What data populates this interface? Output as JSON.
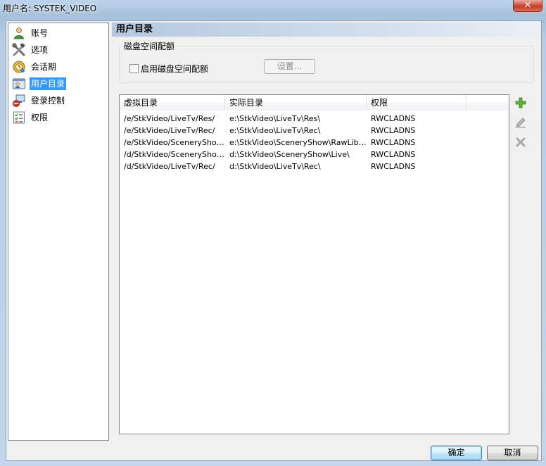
{
  "window": {
    "title": "用户名: SYSTEK_VIDEO",
    "close_glyph": "✕"
  },
  "nav": {
    "items": [
      {
        "label": "账号",
        "icon": "user-icon"
      },
      {
        "label": "选项",
        "icon": "tools-icon"
      },
      {
        "label": "会话期",
        "icon": "session-icon"
      },
      {
        "label": "用户目录",
        "icon": "folder-user-icon",
        "selected": true
      },
      {
        "label": "登录控制",
        "icon": "login-control-icon"
      },
      {
        "label": "权限",
        "icon": "permissions-icon"
      }
    ]
  },
  "section": {
    "title": "用户目录"
  },
  "quota": {
    "group_title": "磁盘空间配额",
    "enable_label": "启用磁盘空间配额",
    "enabled": false,
    "settings_label": "设置..."
  },
  "table": {
    "columns": [
      "虚拟目录",
      "实际目录",
      "权限"
    ],
    "rows": [
      [
        "/e/StkVideo/LiveTv/Res/",
        "e:\\StkVideo\\LiveTv\\Res\\",
        "RWCLADNS"
      ],
      [
        "/e/StkVideo/LiveTv/Rec/",
        "e:\\StkVideo\\LiveTv\\Rec\\",
        "RWCLADNS"
      ],
      [
        "/e/StkVideo/SceneryShow...",
        "e:\\StkVideo\\SceneryShow\\RawLib\\...",
        "RWCLADNS"
      ],
      [
        "/d/StkVideo/SceneryShow...",
        "d:\\StkVideo\\SceneryShow\\Live\\",
        "RWCLADNS"
      ],
      [
        "/d/StkVideo/LiveTv/Rec/",
        "d:\\StkVideo\\LiveTv\\Rec\\",
        "RWCLADNS"
      ]
    ]
  },
  "tools": {
    "add_icon": "add-icon",
    "edit_icon": "edit-icon",
    "delete_icon": "delete-icon"
  },
  "buttons": {
    "ok": "确定",
    "cancel": "取消"
  },
  "colors": {
    "selection": "#3399ff",
    "add": "#5cb531",
    "disabled": "#a0a0a0"
  }
}
